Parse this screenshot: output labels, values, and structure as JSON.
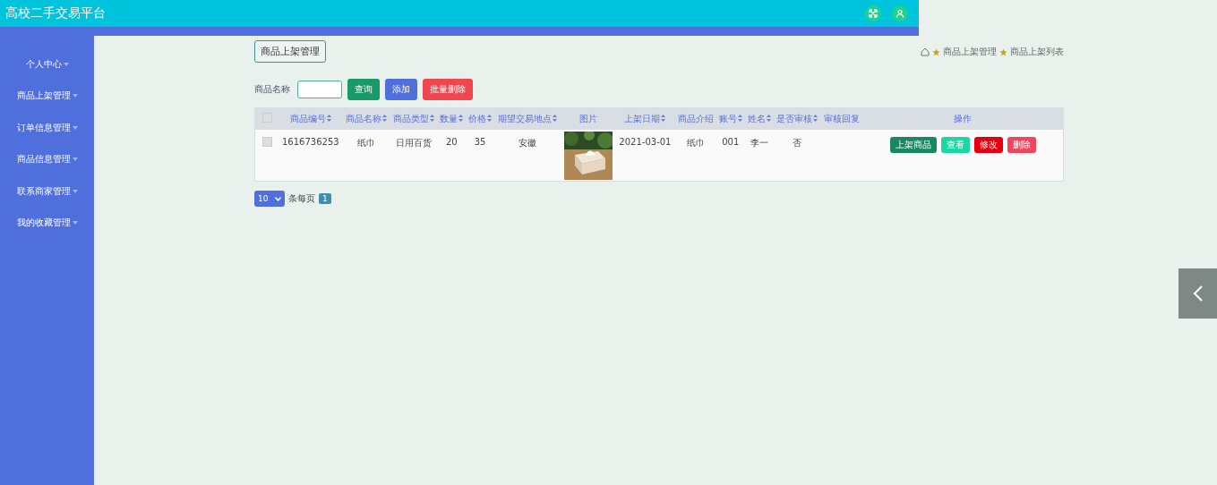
{
  "header": {
    "title": "高校二手交易平台"
  },
  "sidebar": {
    "items": [
      {
        "label": "个人中心",
        "expanded": false
      },
      {
        "label": "商品上架管理",
        "expanded": false
      },
      {
        "label": "订单信息管理",
        "expanded": false
      },
      {
        "label": "商品信息管理",
        "expanded": false
      },
      {
        "label": "联系商家管理",
        "expanded": false
      },
      {
        "label": "我的收藏管理",
        "expanded": false
      }
    ]
  },
  "page_title": "商品上架管理",
  "breadcrumb": [
    "商品上架管理",
    "商品上架列表"
  ],
  "search": {
    "label": "商品名称"
  },
  "toolbar": [
    {
      "label": "查询",
      "kind": "search"
    },
    {
      "label": "添加",
      "kind": "add"
    },
    {
      "label": "批量删除",
      "kind": "batch-delete"
    }
  ],
  "table": {
    "select_all": {
      "checked": false
    },
    "columns": [
      {
        "label": "商品编号",
        "sortable": true
      },
      {
        "label": "商品名称",
        "sortable": true
      },
      {
        "label": "商品类型",
        "sortable": true
      },
      {
        "label": "数量",
        "sortable": true
      },
      {
        "label": "价格",
        "sortable": true
      },
      {
        "label": "期望交易地点",
        "sortable": true
      },
      {
        "label": "图片",
        "sortable": false
      },
      {
        "label": "上架日期",
        "sortable": true
      },
      {
        "label": "商品介绍",
        "sortable": false
      },
      {
        "label": "账号",
        "sortable": true
      },
      {
        "label": "姓名",
        "sortable": true
      },
      {
        "label": "是否审核",
        "sortable": true
      },
      {
        "label": "审核回复",
        "sortable": false
      },
      {
        "label": "操作",
        "sortable": false
      }
    ],
    "rows": [
      {
        "checked": false,
        "cells": [
          "1616736253",
          "纸巾",
          "日用百货",
          "20",
          "35",
          "安徽",
          {
            "kind": "picture"
          },
          "2021-03-01",
          "纸巾",
          "001",
          "李一",
          "否",
          null
        ],
        "actions": [
          {
            "label": "上架商品",
            "kind": "shelve"
          },
          {
            "label": "查看",
            "kind": "view"
          },
          {
            "label": "修改",
            "kind": "edit"
          },
          {
            "label": "删除",
            "kind": "delete"
          }
        ]
      }
    ]
  },
  "pagination": {
    "page_size": "10",
    "page_size_label": "条每页",
    "pages": [
      {
        "label": "1",
        "selected": true
      }
    ]
  }
}
